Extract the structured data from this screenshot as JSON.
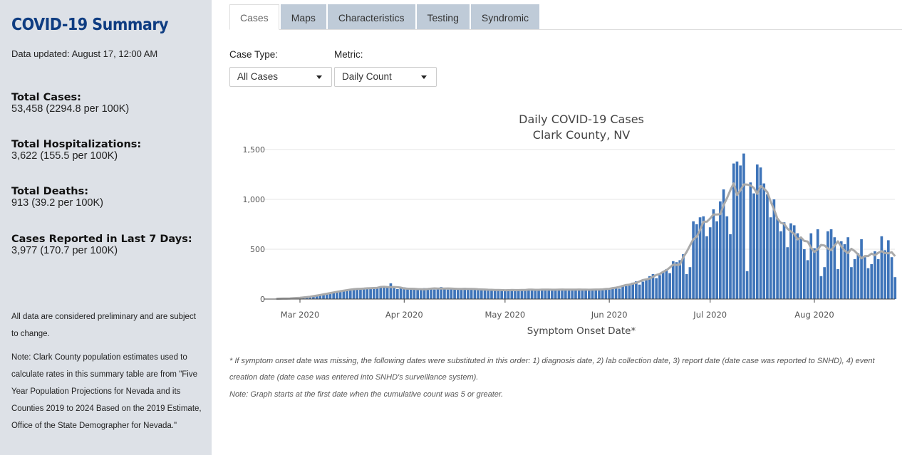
{
  "sidebar": {
    "title": "COVID-19 Summary",
    "updated": "Data updated: August 17, 12:00 AM",
    "stats": [
      {
        "label": "Total Cases:",
        "value": "53,458 (2294.8 per 100K)"
      },
      {
        "label": "Total Hospitalizations:",
        "value": "3,622 (155.5 per 100K)"
      },
      {
        "label": "Total Deaths:",
        "value": "913 (39.2 per 100K)"
      },
      {
        "label": "Cases Reported in Last 7 Days:",
        "value": "3,977 (170.7 per 100K)"
      }
    ],
    "note1": "All data are considered preliminary and are subject to change.",
    "note2": "Note: Clark County population estimates used to calculate rates in this summary table are from \"Five Year Population Projections for Nevada and its Counties 2019 to 2024 Based on the 2019 Estimate, Office of the State Demographer for Nevada.\""
  },
  "tabs": [
    {
      "label": "Cases",
      "active": true
    },
    {
      "label": "Maps",
      "active": false
    },
    {
      "label": "Characteristics",
      "active": false
    },
    {
      "label": "Testing",
      "active": false
    },
    {
      "label": "Syndromic",
      "active": false
    }
  ],
  "filters": {
    "case_type_label": "Case Type:",
    "case_type_value": "All Cases",
    "metric_label": "Metric:",
    "metric_value": "Daily Count"
  },
  "chart_data": {
    "type": "bar",
    "title": "Daily COVID-19 Cases",
    "subtitle": "Clark County, NV",
    "xlabel": "Symptom Onset Date*",
    "ylabel": "",
    "ylim": [
      0,
      1500
    ],
    "yticks": [
      0,
      500,
      1000,
      1500
    ],
    "ytick_labels": [
      "0",
      "500",
      "1,000",
      "1,500"
    ],
    "xtick_labels": [
      "Mar 2020",
      "Apr 2020",
      "May 2020",
      "Jun 2020",
      "Jul 2020",
      "Aug 2020"
    ],
    "xtick_dates": [
      "2020-03-01",
      "2020-04-01",
      "2020-05-01",
      "2020-06-01",
      "2020-07-01",
      "2020-08-01"
    ],
    "start_date": "2020-02-23",
    "grid": true,
    "bar_color": "#3e74b9",
    "trend_color": "#aaaaaa",
    "values": [
      4,
      3,
      2,
      5,
      6,
      8,
      10,
      12,
      15,
      18,
      22,
      28,
      32,
      40,
      48,
      55,
      60,
      68,
      72,
      78,
      85,
      90,
      95,
      100,
      105,
      110,
      108,
      102,
      100,
      112,
      120,
      115,
      118,
      125,
      158,
      110,
      100,
      115,
      118,
      105,
      100,
      98,
      95,
      92,
      110,
      100,
      102,
      95,
      110,
      120,
      112,
      95,
      100,
      108,
      102,
      98,
      112,
      100,
      95,
      105,
      100,
      98,
      95,
      92,
      90,
      88,
      92,
      95,
      90,
      88,
      85,
      80,
      95,
      100,
      92,
      88,
      95,
      90,
      100,
      95,
      92,
      90,
      100,
      95,
      90,
      92,
      95,
      98,
      100,
      95,
      92,
      90,
      95,
      100,
      95,
      92,
      90,
      100,
      98,
      95,
      110,
      120,
      105,
      140,
      130,
      150,
      165,
      178,
      145,
      175,
      190,
      230,
      250,
      210,
      240,
      270,
      300,
      260,
      380,
      370,
      390,
      450,
      250,
      320,
      780,
      750,
      820,
      830,
      630,
      720,
      900,
      780,
      980,
      1100,
      830,
      650,
      1360,
      1380,
      1340,
      1460,
      280,
      1170,
      1060,
      1350,
      1320,
      1160,
      1050,
      820,
      1000,
      810,
      680,
      770,
      520,
      760,
      740,
      660,
      620,
      500,
      390,
      660,
      510,
      700,
      230,
      320,
      680,
      700,
      620,
      300,
      580,
      550,
      620,
      320,
      400,
      460,
      600,
      420,
      310,
      350,
      480,
      400,
      630,
      490,
      590,
      420,
      220
    ]
  },
  "notes": {
    "footnote": "* If symptom onset date was missing, the following dates were substituted in this order: 1) diagnosis date, 2) lab collection date, 3) report date (date case was reported to SNHD), 4) event creation date (date case was entered into SNHD's surveillance system).",
    "start_note": "Note: Graph starts at the first date when the cumulative count was 5 or greater."
  }
}
